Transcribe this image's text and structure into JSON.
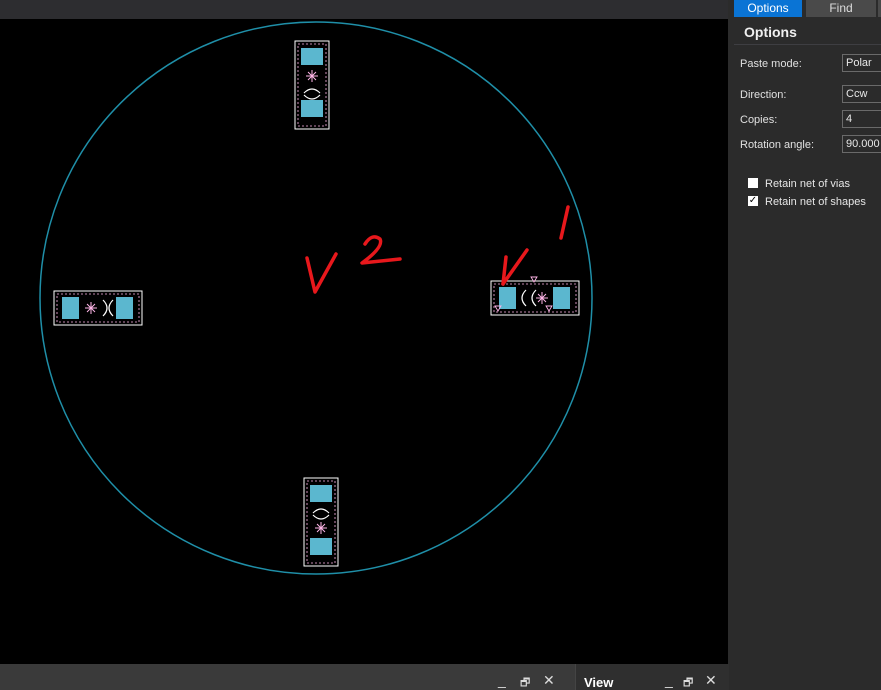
{
  "tabs": {
    "options_label": "Options",
    "find_label": "Find"
  },
  "panel": {
    "title": "Options",
    "paste_mode_label": "Paste mode:",
    "paste_mode_value": "Polar",
    "direction_label": "Direction:",
    "direction_value": "Ccw",
    "copies_label": "Copies:",
    "copies_value": "4",
    "rotation_label": "Rotation angle:",
    "rotation_value": "90.000",
    "retain_vias_label": "Retain net of vias",
    "retain_vias_checked": false,
    "retain_shapes_label": "Retain net of shapes",
    "retain_shapes_checked": true
  },
  "bottom": {
    "view_label": "View",
    "minimize_glyph": "_",
    "restore_glyph": "🗗",
    "close_glyph": "✕"
  },
  "annotations": {
    "v2_text": "V 2",
    "one_text": "1",
    "check_mark": "✓"
  },
  "colors": {
    "circle": "#1f8fa8",
    "pad_fill": "#5bb7cf",
    "outline": "#ffffff",
    "silk": "#ffb6e8",
    "annotation": "#e8181c",
    "tab_active": "#0a74d5"
  }
}
